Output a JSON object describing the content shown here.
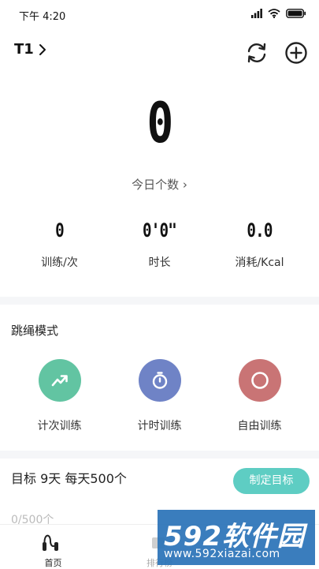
{
  "status_bar": {
    "time": "下午 4:20"
  },
  "header": {
    "device_name": "T1"
  },
  "today": {
    "count": "0",
    "link_label": "今日个数 ›"
  },
  "stats": [
    {
      "value": "0",
      "label": "训练/次"
    },
    {
      "value": "0'0\"",
      "label": "时长"
    },
    {
      "value": "0.0",
      "label": "消耗/Kcal"
    }
  ],
  "modes": {
    "title": "跳绳模式",
    "items": [
      {
        "label": "计次训练",
        "color": "#62c4a2",
        "icon": "trend-up-icon"
      },
      {
        "label": "计时训练",
        "color": "#6f83c6",
        "icon": "stopwatch-icon"
      },
      {
        "label": "自由训练",
        "color": "#c97475",
        "icon": "circle-icon"
      }
    ]
  },
  "goal": {
    "text": "目标 9天 每天500个",
    "button_label": "制定目标",
    "progress": "0/500个"
  },
  "tabbar": {
    "items": [
      {
        "label": "首页"
      },
      {
        "label": "排行榜"
      }
    ]
  },
  "watermark": {
    "main": "592软件园",
    "sub": "www.592xiazai.com"
  }
}
